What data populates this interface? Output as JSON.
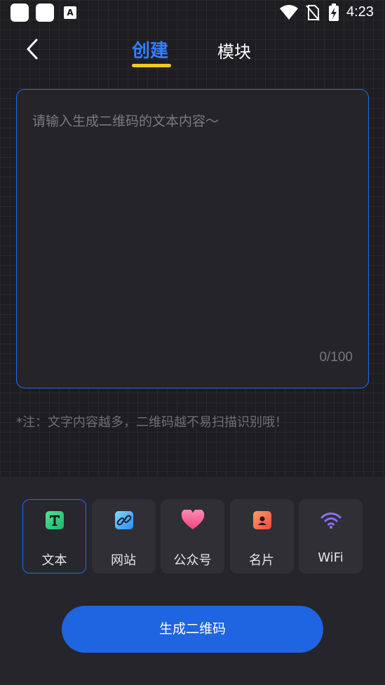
{
  "status_bar": {
    "time": "4:23",
    "badge_letter": "A"
  },
  "header": {
    "tabs": [
      {
        "label": "创建",
        "active": true
      },
      {
        "label": "模块",
        "active": false
      }
    ]
  },
  "editor": {
    "placeholder": "请输入生成二维码的文本内容～",
    "value": "",
    "counter": "0/100"
  },
  "note": "*注：文字内容越多，二维码越不易扫描识别哦！",
  "types": [
    {
      "label": "文本",
      "icon": "text-t-icon",
      "active": true
    },
    {
      "label": "网站",
      "icon": "link-icon",
      "active": false
    },
    {
      "label": "公众号",
      "icon": "heart-icon",
      "active": false
    },
    {
      "label": "名片",
      "icon": "contact-card-icon",
      "active": false
    },
    {
      "label": "WiFi",
      "icon": "wifi-icon",
      "active": false
    }
  ],
  "generate_button": "生成二维码",
  "colors": {
    "accent": "#1f6cf2",
    "underline": "#f4c81a",
    "background": "#1d1c21"
  }
}
